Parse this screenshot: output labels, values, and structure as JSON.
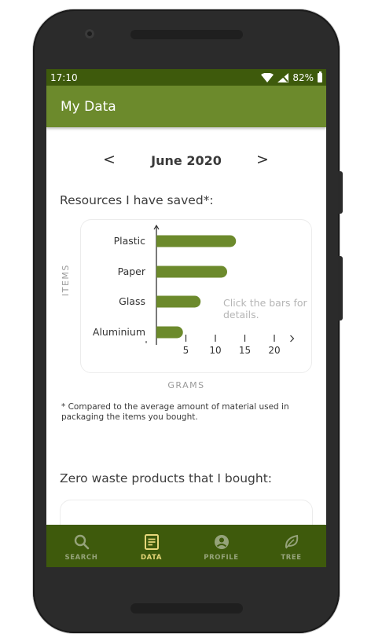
{
  "status_bar": {
    "time": "17:10",
    "battery": "82%"
  },
  "app_bar": {
    "title": "My Data"
  },
  "month_nav": {
    "prev": "<",
    "label": "June 2020",
    "next": ">"
  },
  "resources_section": {
    "title": "Resources I have saved*:",
    "hint": "Click the bars for details.",
    "footnote": "* Compared to the average amount of material used in packaging the items you bought."
  },
  "chart_data": {
    "type": "bar",
    "orientation": "horizontal",
    "categories": [
      "Plastic",
      "Paper",
      "Glass",
      "Aluminium"
    ],
    "values": [
      13.5,
      12,
      7.5,
      4.5
    ],
    "xlabel": "GRAMS",
    "ylabel": "ITEMS",
    "xticks": [
      5,
      10,
      15,
      20
    ],
    "xlim": [
      0,
      23
    ],
    "bar_color": "#6c8a2c",
    "grid": false
  },
  "products_section": {
    "title": "Zero waste products that I bought:"
  },
  "bottom_nav": {
    "items": [
      {
        "label": "SEARCH",
        "icon": "search-icon",
        "active": false
      },
      {
        "label": "DATA",
        "icon": "data-icon",
        "active": true
      },
      {
        "label": "PROFILE",
        "icon": "profile-icon",
        "active": false
      },
      {
        "label": "TREE",
        "icon": "leaf-icon",
        "active": false
      }
    ]
  },
  "colors": {
    "status_bar": "#3e5a0c",
    "app_bar": "#6c8a2c",
    "bottom_nav": "#3e5a0c",
    "nav_active": "#e6d77a",
    "nav_inactive": "#95a37a"
  }
}
